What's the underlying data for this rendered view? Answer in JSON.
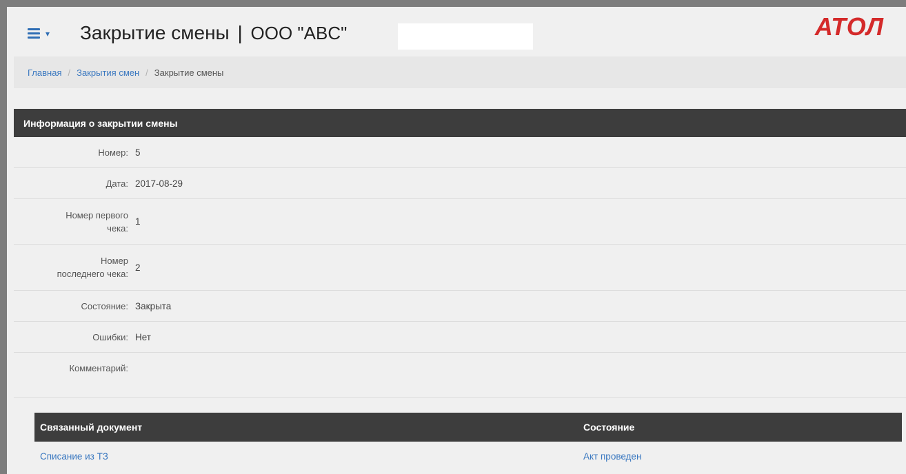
{
  "header": {
    "title": "Закрытие смены",
    "separator": "|",
    "organization": "ООО \"ABC\"",
    "logo_text": "АТОЛ",
    "menu_caret": "▾"
  },
  "breadcrumb": {
    "items": [
      "Главная",
      "Закрытия смен",
      "Закрытие смены"
    ],
    "separator": "/"
  },
  "panel": {
    "title": "Информация о закрытии смены",
    "fields": {
      "number_label": "Номер:",
      "number_value": "5",
      "date_label": "Дата:",
      "date_value": "2017-08-29",
      "first_check_label_1": "Номер первого",
      "first_check_label_2": "чека:",
      "first_check_value": "1",
      "last_check_label_1": "Номер",
      "last_check_label_2": "последнего чека:",
      "last_check_value": "2",
      "state_label": "Состояние:",
      "state_value": "Закрыта",
      "errors_label": "Ошибки:",
      "errors_value": "Нет",
      "comment_label": "Комментарий:",
      "comment_value": ""
    }
  },
  "documents": {
    "headers": [
      "Связанный документ",
      "Состояние"
    ],
    "rows": [
      {
        "document": "Списание из ТЗ",
        "state": "Акт проведен"
      }
    ]
  },
  "colors": {
    "accent": "#2e6db4",
    "logo": "#d42a2a",
    "header_bar": "#3d3d3d",
    "link": "#3a78c0"
  }
}
